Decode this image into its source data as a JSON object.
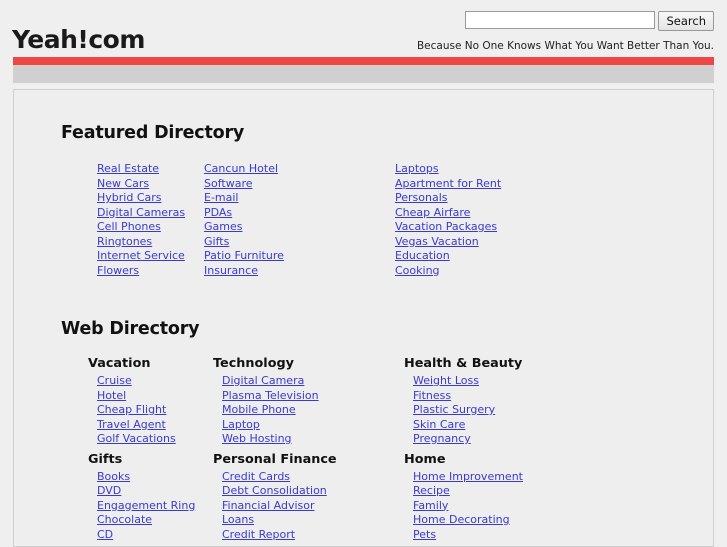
{
  "header": {
    "logo": "Yeah!com",
    "tagline": "Because No One Knows What You Want Better Than You.",
    "search": {
      "value": "",
      "placeholder": "",
      "button_label": "Search"
    }
  },
  "colors": {
    "accent_bar": "#ef4747",
    "secondary_bar": "#d0d0d0",
    "link": "#3a3ad0",
    "page_background": "#efefef",
    "panel_background": "#eeeeee",
    "panel_border": "#cfcfcf"
  },
  "featured": {
    "title": "Featured Directory",
    "columns": [
      {
        "links": [
          "Real Estate",
          "New Cars",
          "Hybrid Cars",
          "Digital Cameras",
          "Cell Phones",
          "Ringtones",
          "Internet Service",
          "Flowers"
        ]
      },
      {
        "links": [
          "Cancun Hotel",
          "Software",
          "E-mail",
          "PDAs",
          "Games",
          "Gifts",
          "Patio Furniture",
          "Insurance"
        ]
      },
      {
        "links": [
          "Laptops",
          "Apartment for Rent",
          "Personals",
          "Cheap Airfare",
          "Vacation Packages",
          "Vegas Vacation",
          "Education",
          "Cooking"
        ]
      }
    ]
  },
  "web_directory": {
    "title": "Web Directory",
    "columns": [
      {
        "categories": [
          {
            "name": "Vacation",
            "links": [
              "Cruise",
              "Hotel",
              "Cheap Flight",
              "Travel Agent",
              "Golf Vacations"
            ]
          },
          {
            "name": "Gifts",
            "links": [
              "Books",
              "DVD",
              "Engagement Ring",
              "Chocolate",
              "CD"
            ]
          }
        ]
      },
      {
        "categories": [
          {
            "name": "Technology",
            "links": [
              "Digital Camera",
              "Plasma Television",
              "Mobile Phone",
              "Laptop",
              "Web Hosting"
            ]
          },
          {
            "name": "Personal Finance",
            "links": [
              "Credit Cards",
              "Debt Consolidation",
              "Financial Advisor",
              "Loans",
              "Credit Report"
            ]
          }
        ]
      },
      {
        "categories": [
          {
            "name": "Health & Beauty",
            "links": [
              "Weight Loss",
              "Fitness",
              "Plastic Surgery",
              "Skin Care",
              "Pregnancy"
            ]
          },
          {
            "name": "Home",
            "links": [
              "Home Improvement",
              "Recipe",
              "Family",
              "Home Decorating",
              "Pets"
            ]
          }
        ]
      }
    ]
  }
}
